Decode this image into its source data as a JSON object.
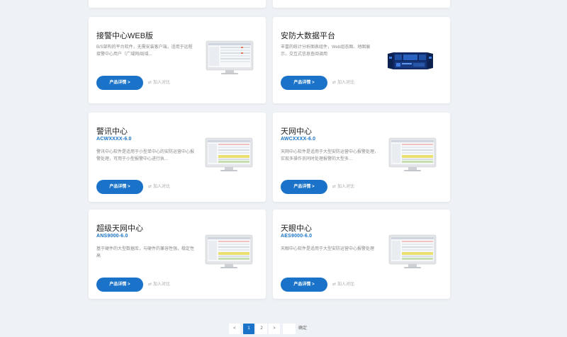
{
  "cards": [
    {
      "id": "top-left-partial",
      "title": "",
      "code": "",
      "desc": "",
      "button": "",
      "compare": ""
    },
    {
      "id": "top-right-partial",
      "title": "",
      "code": "",
      "desc": "",
      "button": "",
      "compare": ""
    },
    {
      "id": "jiejing-web",
      "title": "接警中心WEB版",
      "code": "",
      "desc": "B/S架构的平台软件，无需安装客户端，适用于远程接警中心用户（广域网/局域...",
      "button": "产品详情 >",
      "compare": "加入对比",
      "thumb": "monitor"
    },
    {
      "id": "anfang-bigdata",
      "title": "安防大数据平台",
      "code": "",
      "desc": "丰富的统计分析图表组件，Web组态图、地图展示，交互式信息查阅调用",
      "button": "产品详情 >",
      "compare": "加入对比",
      "thumb": "videowall"
    },
    {
      "id": "jingxun",
      "title": "警讯中心",
      "code": "ACWXXXX-6.0",
      "desc": "警讯中心软件是适用于小型单中心的安防运营中心报警处理，可用于小型报警中心进行执...",
      "button": "产品详情 >",
      "compare": "加入对比",
      "thumb": "monitor"
    },
    {
      "id": "tianwang",
      "title": "天网中心",
      "code": "AWCXXXX-6.0",
      "desc": "天网中心软件是适用于大型安防运营中心报警处理，实现多操作员同时处理报警的大型多...",
      "button": "产品详情 >",
      "compare": "加入对比",
      "thumb": "monitor"
    },
    {
      "id": "chaoji-tianwang",
      "title": "超级天网中心",
      "code": "ANS9000-6.0",
      "desc": "基于硬件的大型数据库，与硬件的兼容性强，稳定性高",
      "button": "产品详情 >",
      "compare": "加入对比",
      "thumb": "monitor"
    },
    {
      "id": "tianyan",
      "title": "天眼中心",
      "code": "AES9000-6.0",
      "desc": "天眼中心软件是适用于大型安防运营中心报警处理",
      "button": "产品详情 >",
      "compare": "加入对比",
      "thumb": "monitor"
    }
  ],
  "pagination": {
    "prev": "<",
    "pages": [
      "1",
      "2"
    ],
    "current": "1",
    "next": ">",
    "goto_value": "",
    "confirm": "确定"
  },
  "colors": {
    "accent": "#1a73c8",
    "background": "#eef1f5",
    "card": "#ffffff"
  }
}
